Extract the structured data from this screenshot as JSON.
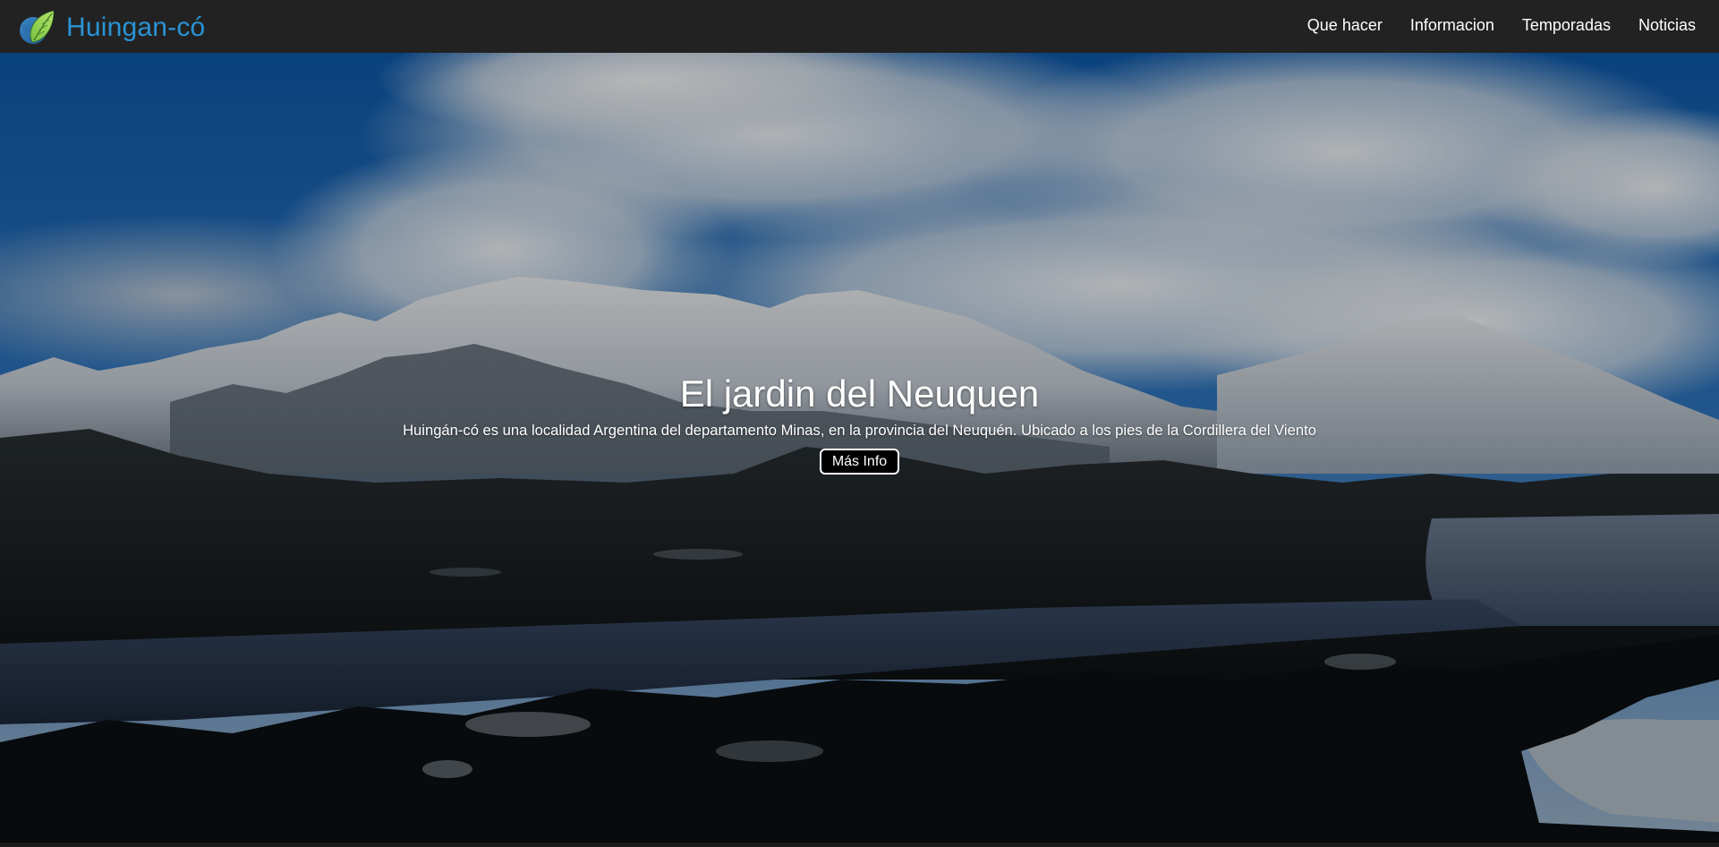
{
  "brand": {
    "name": "Huingan-có",
    "logo_icon": "leaf-globe-icon"
  },
  "nav": {
    "items": [
      {
        "label": "Que hacer"
      },
      {
        "label": "Informacion"
      },
      {
        "label": "Temporadas"
      },
      {
        "label": "Noticias"
      }
    ]
  },
  "hero": {
    "title": "El jardin del Neuquen",
    "subtitle": "Huingán-có es una localidad Argentina del departamento Minas, en la provincia del Neuquén. Ubicado a los pies de la Cordillera del Viento",
    "button_label": "Más Info",
    "background_image": "snowy-mountains-lake-landscape"
  },
  "colors": {
    "navbar_bg": "#222222",
    "brand_text": "#2a93d5",
    "nav_text": "#ffffff",
    "button_bg": "#000000",
    "button_border": "#ffffff"
  }
}
